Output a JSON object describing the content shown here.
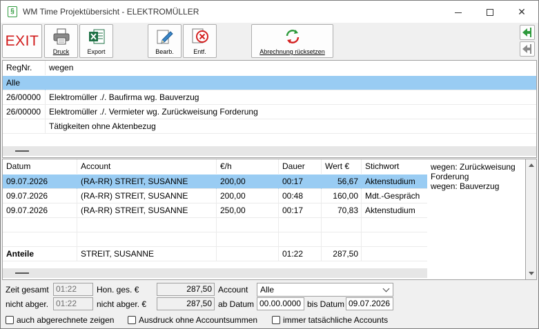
{
  "window": {
    "title": "WM Time Projektübersicht - ELEKTROMÜLLER",
    "controls": {
      "minimize": "minimize",
      "maximize": "maximize",
      "close": "✕"
    }
  },
  "toolbar": {
    "exit_label": "EXIT",
    "druck_label": "Druck",
    "export_label": "Export",
    "bearb_label": "Bearb.",
    "entf_label": "Entf.",
    "reset_label": "Abrechnung rücksetzen"
  },
  "files_table": {
    "headers": {
      "regnr": "RegNr.",
      "wegen": "wegen"
    },
    "rows": [
      {
        "regnr": "Alle",
        "wegen": ""
      },
      {
        "regnr": "26/00000",
        "wegen": "Elektromüller ./. Baufirma wg. Bauverzug"
      },
      {
        "regnr": "26/00000",
        "wegen": "Elektromüller ./. Vermieter wg. Zurückweisung Forderung"
      },
      {
        "regnr": "",
        "wegen": "Tätigkeiten ohne Aktenbezug"
      }
    ]
  },
  "entries_table": {
    "headers": {
      "datum": "Datum",
      "account": "Account",
      "rate": "€/h",
      "dauer": "Dauer",
      "wert": "Wert €",
      "stichwort": "Stichwort"
    },
    "rows": [
      {
        "datum": "09.07.2026",
        "account": "(RA-RR) STREIT, SUSANNE",
        "rate": "200,00",
        "dauer": "00:17",
        "wert": "56,67",
        "stichwort": "Aktenstudium"
      },
      {
        "datum": "09.07.2026",
        "account": "(RA-RR) STREIT, SUSANNE",
        "rate": "200,00",
        "dauer": "00:48",
        "wert": "160,00",
        "stichwort": "Mdt.-Gespräch"
      },
      {
        "datum": "09.07.2026",
        "account": "(RA-RR) STREIT, SUSANNE",
        "rate": "250,00",
        "dauer": "00:17",
        "wert": "70,83",
        "stichwort": "Aktenstudium"
      }
    ],
    "summary": {
      "label": "Anteile",
      "account": "STREIT, SUSANNE",
      "dauer": "01:22",
      "wert": "287,50"
    }
  },
  "side_note": {
    "line1": "wegen: Zurückweisung",
    "line2": "Forderung",
    "line3": "wegen: Bauverzug"
  },
  "footer": {
    "zeit_gesamt_label": "Zeit gesamt",
    "zeit_gesamt_value": "01:22",
    "nicht_abger_label": "nicht abger.",
    "nicht_abger_value": "01:22",
    "hon_ges_label": "Hon. ges. €",
    "hon_ges_value": "287,50",
    "hon_nicht_abger_label": "nicht abger. €",
    "hon_nicht_abger_value": "287,50",
    "account_label": "Account",
    "account_value": "Alle",
    "ab_datum_label": "ab Datum",
    "ab_datum_value": "00.00.0000",
    "bis_datum_label": "bis Datum",
    "bis_datum_value": "09.07.2026",
    "chk_abgerechnete": "auch abgerechnete zeigen",
    "chk_ausdruck": "Ausdruck ohne Accountsummen",
    "chk_tatsaechlich": "immer tatsächliche Accounts"
  },
  "colors": {
    "selection": "#99ccf3",
    "exit_red": "#d11a1a",
    "excel_green": "#1e7145",
    "nav_green": "#2e9a3c"
  }
}
